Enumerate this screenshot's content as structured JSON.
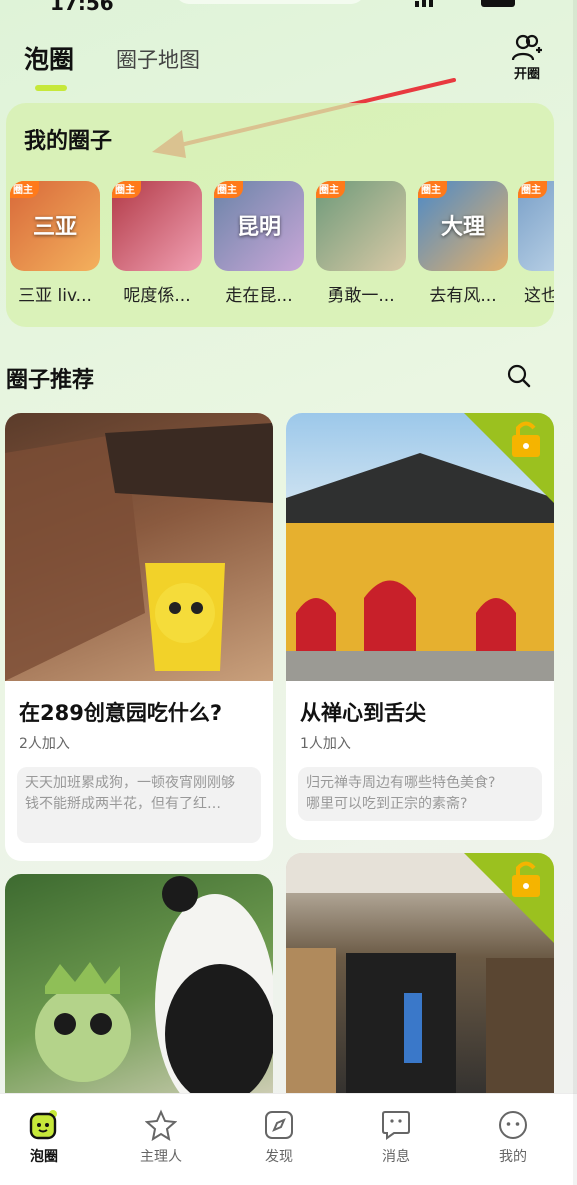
{
  "status": {
    "time": "17:56"
  },
  "topnav": {
    "active_tab": "泡圈",
    "inactive_tab": "圈子地图",
    "open_circle_label": "开圈"
  },
  "my_circles": {
    "title": "我的圈子",
    "badge_label": "圈主",
    "items": [
      {
        "name": "三亚 liv...",
        "thumb_text": "三亚",
        "colors": [
          "#d8693a",
          "#f4b15d"
        ]
      },
      {
        "name": "呢度係...",
        "thumb_text": "",
        "colors": [
          "#b23a47",
          "#f1a0b3"
        ]
      },
      {
        "name": "走在昆...",
        "thumb_text": "昆明",
        "colors": [
          "#6b84a8",
          "#c9a7d8"
        ]
      },
      {
        "name": "勇敢一...",
        "thumb_text": "",
        "colors": [
          "#6e9a7a",
          "#d9c9a6"
        ]
      },
      {
        "name": "去有风...",
        "thumb_text": "大理",
        "colors": [
          "#4d8ac7",
          "#e3b06a"
        ]
      },
      {
        "name": "这也",
        "thumb_text": "",
        "colors": [
          "#7aa0c8",
          "#cde0ef"
        ]
      }
    ]
  },
  "recommend": {
    "title": "圈子推荐",
    "cards": [
      {
        "title": "在289创意园吃什么?",
        "count": "2人加入",
        "snippet": "天天加班累成狗，一顿夜宵刚刚够\n钱不能掰成两半花，但有了红…",
        "locked": false,
        "colors": [
          "#8a5a3f",
          "#c9a07c"
        ]
      },
      {
        "title": "从禅心到舌尖",
        "count": "1人加入",
        "snippet": "归元禅寺周边有哪些特色美食?\n哪里可以吃到正宗的素斋?",
        "locked": true,
        "colors": [
          "#e8b43a",
          "#c03028"
        ]
      },
      {
        "title": "",
        "count": "",
        "snippet": "",
        "locked": false,
        "colors": [
          "#4f7d3e",
          "#e9e6dc"
        ]
      },
      {
        "title": "",
        "count": "",
        "snippet": "",
        "locked": true,
        "colors": [
          "#6b5a45",
          "#2c2c2c"
        ]
      }
    ]
  },
  "tabbar": {
    "items": [
      {
        "label": "泡圈",
        "active": true
      },
      {
        "label": "主理人",
        "active": false
      },
      {
        "label": "发现",
        "active": false
      },
      {
        "label": "消息",
        "active": false
      },
      {
        "label": "我的",
        "active": false
      }
    ]
  },
  "accent_colors": {
    "lime": "#c6e83a",
    "lock_green": "#9bc11f",
    "badge_orange": "#ff7a1a",
    "arrow_red": "#e8393f"
  }
}
